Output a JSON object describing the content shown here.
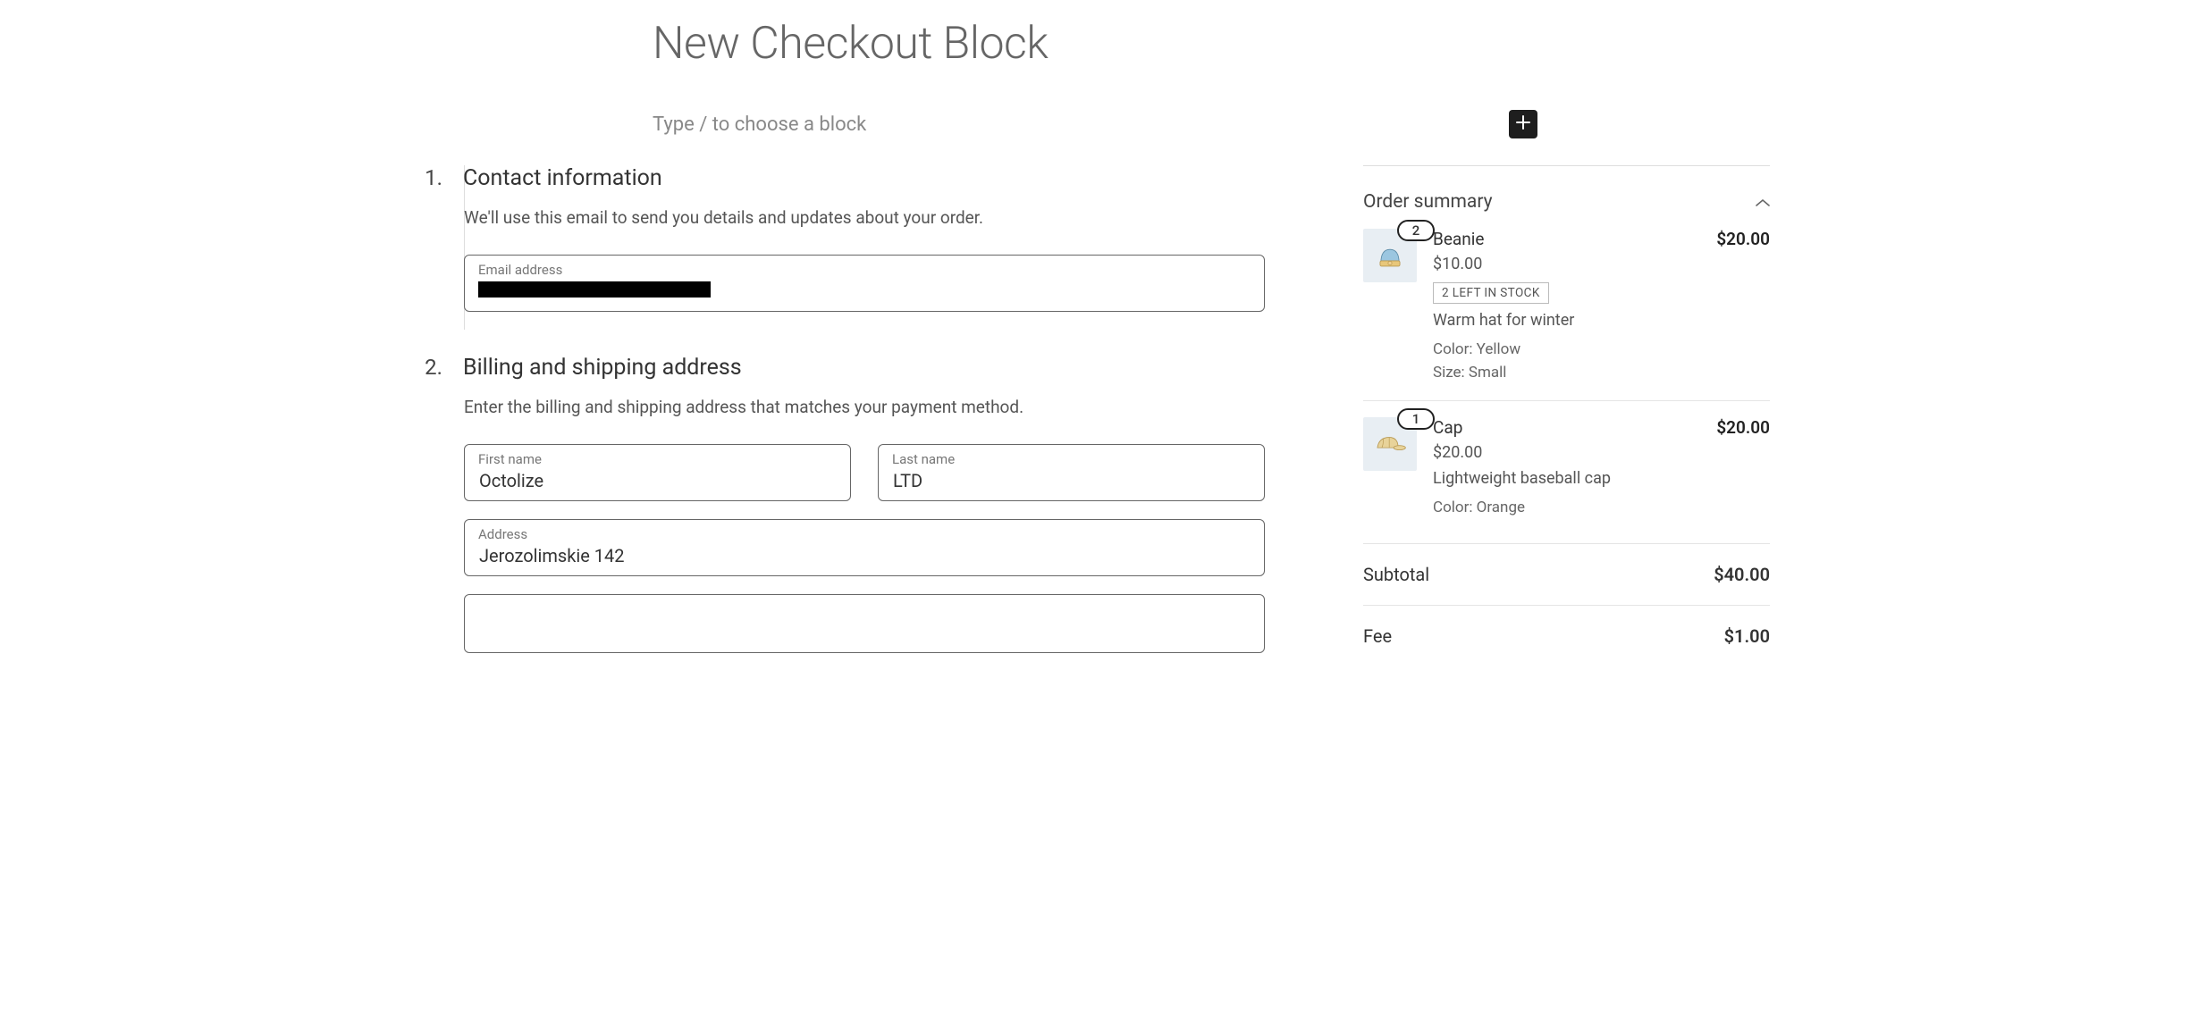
{
  "page": {
    "title": "New Checkout Block",
    "block_prompt": "Type / to choose a block"
  },
  "steps": {
    "contact": {
      "number": "1.",
      "title": "Contact information",
      "desc": "We'll use this email to send you details and updates about your order.",
      "email_label": "Email address",
      "email_value": ""
    },
    "billing": {
      "number": "2.",
      "title": "Billing and shipping address",
      "desc": "Enter the billing and shipping address that matches your payment method.",
      "first_name_label": "First name",
      "first_name_value": "Octolize",
      "last_name_label": "Last name",
      "last_name_value": "LTD",
      "address_label": "Address",
      "address_value": "Jerozolimskie 142"
    }
  },
  "summary": {
    "title": "Order summary",
    "items": [
      {
        "qty": "2",
        "name": "Beanie",
        "total": "$20.00",
        "unit": "$10.00",
        "stock": "2 LEFT IN STOCK",
        "desc": "Warm hat for winter",
        "meta1": "Color: Yellow",
        "meta2": "Size: Small"
      },
      {
        "qty": "1",
        "name": "Cap",
        "total": "$20.00",
        "unit": "$20.00",
        "stock": "",
        "desc": "Lightweight baseball cap",
        "meta1": "Color: Orange",
        "meta2": ""
      }
    ],
    "subtotal_label": "Subtotal",
    "subtotal_value": "$40.00",
    "fee_label": "Fee",
    "fee_value": "$1.00"
  }
}
